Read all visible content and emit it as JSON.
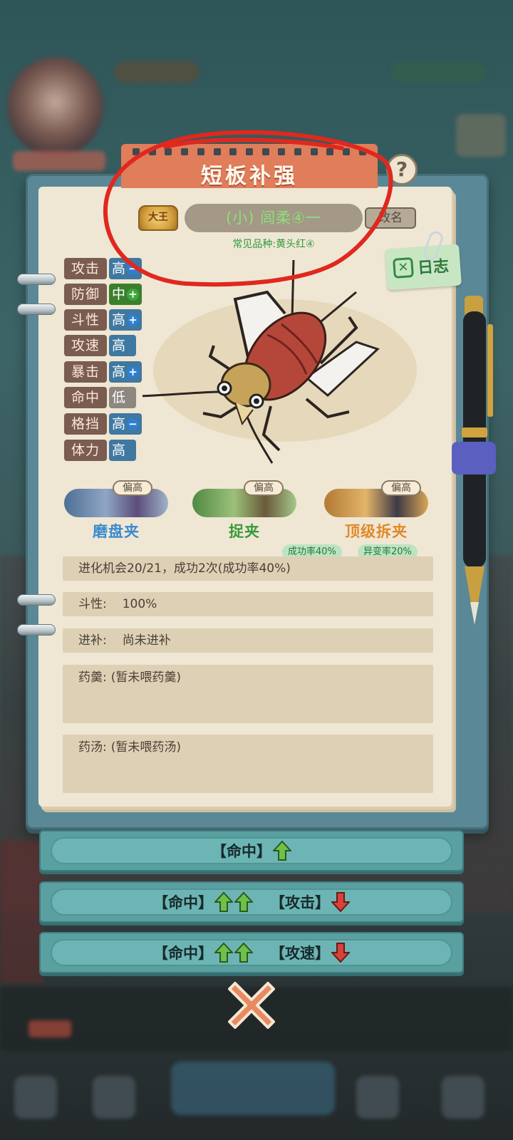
{
  "title": "短板补强",
  "help_label": "?",
  "cricket": {
    "rank_badge": "大王",
    "name": "(小) 闾柔④一",
    "rename_label": "改名",
    "breed_line": "常见品种:黄头红④"
  },
  "log": {
    "label": "日志"
  },
  "attributes": [
    {
      "label": "攻击",
      "value": "高",
      "mark": "minus"
    },
    {
      "label": "防御",
      "value": "中",
      "mark": "plus"
    },
    {
      "label": "斗性",
      "value": "高",
      "mark": "plus"
    },
    {
      "label": "攻速",
      "value": "高",
      "mark": ""
    },
    {
      "label": "暴击",
      "value": "高",
      "mark": "plus"
    },
    {
      "label": "命中",
      "value": "低",
      "mark": ""
    },
    {
      "label": "格挡",
      "value": "高",
      "mark": "minus"
    },
    {
      "label": "体力",
      "value": "高",
      "mark": ""
    }
  ],
  "skills": [
    {
      "name": "磨盘夹",
      "badge": "偏高",
      "color": "#3a8ad0"
    },
    {
      "name": "捉夹",
      "badge": "偏高",
      "color": "#3a9a3a"
    },
    {
      "name": "顶级拆夹",
      "badge": "偏高",
      "color": "#e08a2a"
    }
  ],
  "chips": {
    "success_rate": "成功率40%",
    "mutation_rate": "异变率20%"
  },
  "info": {
    "evolution": "进化机会20/21，成功2次(成功率40%)",
    "fight_key": "斗性:",
    "fight_val": "100%",
    "supplement_key": "进补:",
    "supplement_val": "尚未进补",
    "paste_key": "药羹:",
    "paste_val": "(暂未喂药羹)",
    "soup_key": "药汤:",
    "soup_val": "(暂未喂药汤)"
  },
  "options": [
    {
      "stat1": "【命中】",
      "stat2": ""
    },
    {
      "stat1": "【命中】",
      "stat2": "【攻击】"
    },
    {
      "stat1": "【命中】",
      "stat2": "【攻速】"
    }
  ],
  "colors": {
    "stat_high": "#3f78a0",
    "stat_mid": "#3b7f2c",
    "stat_low": "#8d8780",
    "arrow_up": "#6fc04a",
    "arrow_down": "#d9423a",
    "accent_title": "#e07d5a",
    "annotation_circle": "#e0281e"
  }
}
